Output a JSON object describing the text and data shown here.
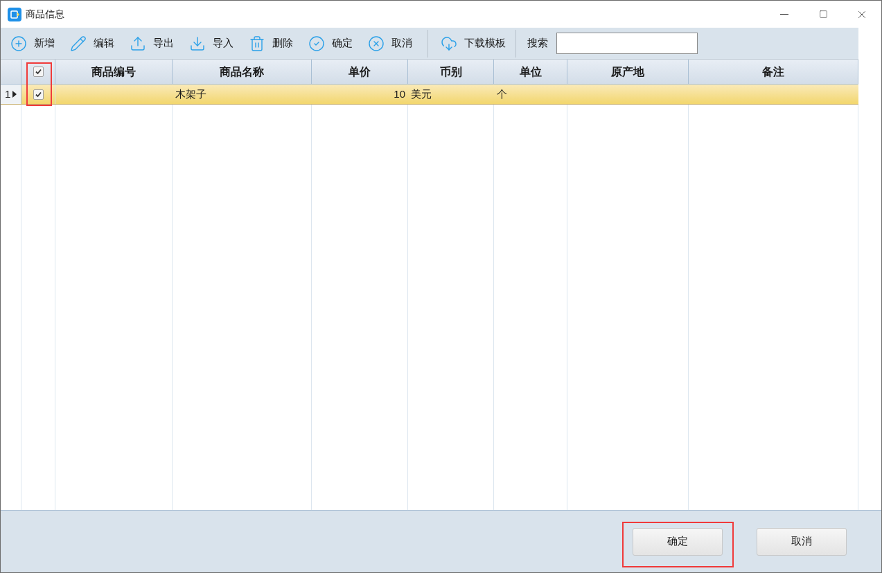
{
  "window": {
    "title": "商品信息"
  },
  "toolbar": [
    {
      "kind": "add",
      "label": "新增"
    },
    {
      "kind": "edit",
      "label": "编辑"
    },
    {
      "kind": "export",
      "label": "导出"
    },
    {
      "kind": "import",
      "label": "导入"
    },
    {
      "kind": "delete",
      "label": "删除"
    },
    {
      "kind": "confirm",
      "label": "确定"
    },
    {
      "kind": "cancel",
      "label": "取消"
    },
    {
      "kind": "template",
      "label": "下载模板"
    }
  ],
  "search": {
    "label": "搜索"
  },
  "table": {
    "select_all_checked": true,
    "columns": [
      "商品编号",
      "商品名称",
      "单价",
      "币别",
      "单位",
      "原产地",
      "备注"
    ],
    "rows": [
      {
        "number": "1",
        "selected": true,
        "checked": true,
        "cells": [
          "",
          "木架子",
          "10",
          "美元",
          "个",
          "",
          ""
        ]
      }
    ]
  },
  "buttons": [
    "确定",
    "取消"
  ]
}
